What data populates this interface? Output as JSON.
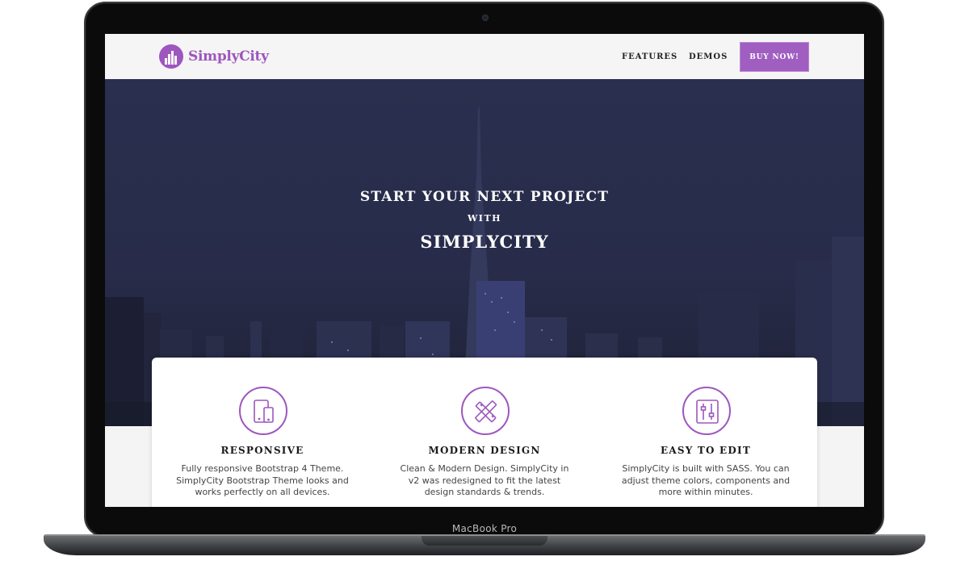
{
  "device": {
    "label": "MacBook Pro"
  },
  "navbar": {
    "brand": "SimplyCity",
    "links": [
      {
        "label": "FEATURES"
      },
      {
        "label": "DEMOS"
      }
    ],
    "cta": "BUY NOW!"
  },
  "hero": {
    "line1": "START YOUR NEXT PROJECT",
    "line2": "WITH",
    "line3": "SIMPLYCITY"
  },
  "features": [
    {
      "icon": "devices-icon",
      "title": "RESPONSIVE",
      "description": "Fully responsive Bootstrap 4 Theme. SimplyCity Bootstrap Theme looks and works perfectly on all devices."
    },
    {
      "icon": "pencil-ruler-icon",
      "title": "MODERN DESIGN",
      "description": "Clean & Modern Design. SimplyCity in v2 was redesigned to fit the latest design standards & trends."
    },
    {
      "icon": "sliders-icon",
      "title": "EASY TO EDIT",
      "description": "SimplyCity is built with SASS. You can adjust theme colors, components and more within minutes."
    }
  ],
  "colors": {
    "accent": "#9d57be",
    "hero_dark": "#262b47"
  }
}
